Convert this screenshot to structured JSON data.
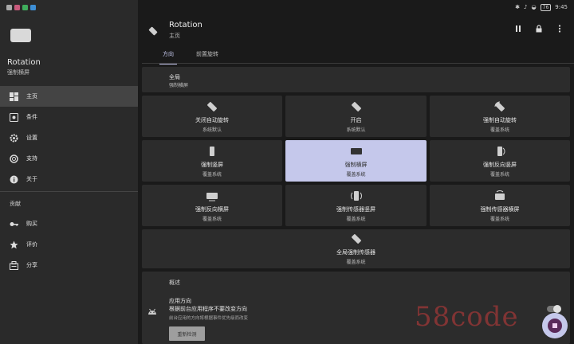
{
  "status_bar": {
    "time": "9:45",
    "battery": "76"
  },
  "sidebar": {
    "app_name": "Rotation",
    "app_subtitle": "强制横屏",
    "items": [
      {
        "label": "主页",
        "icon": "dashboard-icon",
        "active": true
      },
      {
        "label": "条件",
        "icon": "conditions-icon",
        "active": false
      },
      {
        "label": "设置",
        "icon": "gear-icon",
        "active": false
      },
      {
        "label": "支持",
        "icon": "lifebuoy-icon",
        "active": false
      },
      {
        "label": "关于",
        "icon": "info-icon",
        "active": false
      }
    ],
    "section_label": "贡献",
    "contrib_items": [
      {
        "label": "购买",
        "icon": "key-icon"
      },
      {
        "label": "评价",
        "icon": "star-icon"
      },
      {
        "label": "分享",
        "icon": "share-icon"
      }
    ]
  },
  "header": {
    "title": "Rotation",
    "subtitle": "主页"
  },
  "tabs": [
    {
      "label": "方向",
      "active": true
    },
    {
      "label": "前置旋转",
      "active": false
    }
  ],
  "global": {
    "title": "全局",
    "subtitle": "强制横屏"
  },
  "tiles": [
    {
      "title": "关闭自动旋转",
      "sub": "系统默认",
      "icon": "rotate-off-icon",
      "selected": false
    },
    {
      "title": "开启",
      "sub": "系统默认",
      "icon": "rotate-on-icon",
      "selected": false
    },
    {
      "title": "强制自动旋转",
      "sub": "覆盖系统",
      "icon": "rotate-auto-icon",
      "selected": false
    },
    {
      "title": "强制竖屏",
      "sub": "覆盖系统",
      "icon": "portrait-icon",
      "selected": false
    },
    {
      "title": "强制横屏",
      "sub": "覆盖系统",
      "icon": "landscape-icon",
      "selected": true
    },
    {
      "title": "强制反向竖屏",
      "sub": "覆盖系统",
      "icon": "portrait-reverse-icon",
      "selected": false
    },
    {
      "title": "强制反向横屏",
      "sub": "覆盖系统",
      "icon": "landscape-reverse-icon",
      "selected": false
    },
    {
      "title": "强制传感器竖屏",
      "sub": "覆盖系统",
      "icon": "sensor-portrait-icon",
      "selected": false
    },
    {
      "title": "强制传感器横屏",
      "sub": "覆盖系统",
      "icon": "sensor-landscape-icon",
      "selected": false
    },
    {
      "title": "全局强制传感器",
      "sub": "覆盖系统",
      "icon": "full-sensor-icon",
      "selected": false
    }
  ],
  "overview": {
    "label": "概述",
    "title": "应用方向",
    "description": "根据前台应用程序不要改变方向",
    "note": "前台应用的方向将根据事件优先级而改变",
    "button_label": "重新检测"
  },
  "watermark": "58code",
  "colors": {
    "accent": "#c5c8eb",
    "background": "#1a1a1a",
    "sidebar": "#2a2a2a",
    "tile": "#2c2c2c"
  }
}
